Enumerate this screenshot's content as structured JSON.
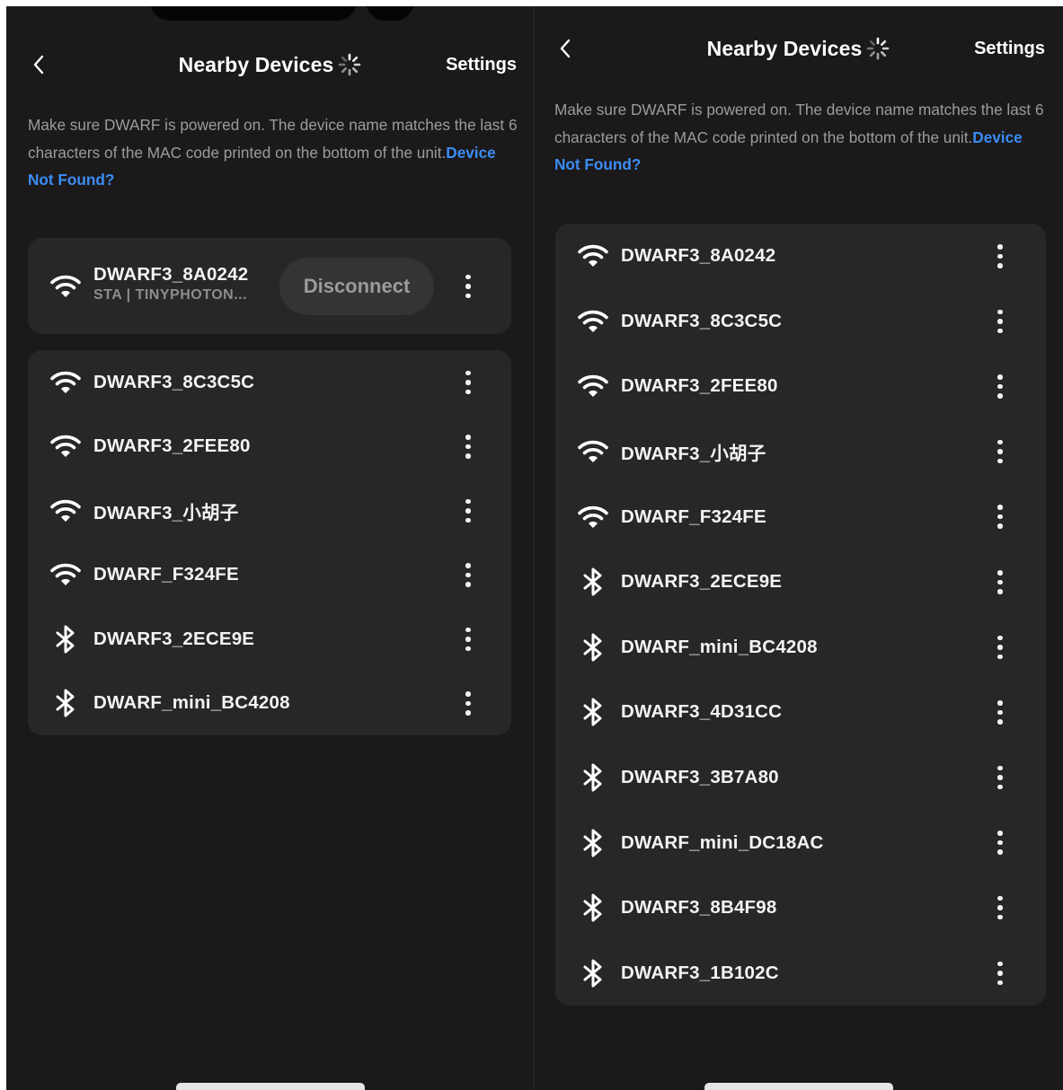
{
  "icons": {
    "wifi": "wifi-icon",
    "bluetooth": "bluetooth-icon",
    "back": "chevron-left-icon",
    "scan": "loading-spinner-icon",
    "more": "more-vertical-icon"
  },
  "colors": {
    "background": "#1b191a",
    "card": "#282627",
    "link": "#3b8df5",
    "muted_text": "#9d9b9c"
  },
  "left_screen": {
    "header": {
      "title": "Nearby Devices",
      "settings_label": "Settings"
    },
    "description": {
      "text": "Make sure DWARF is powered on. The device name matches the last 6 characters of the MAC code printed on the bottom of the unit.",
      "link": "Device Not Found?"
    },
    "connected_device": {
      "name": "DWARF3_8A0242",
      "subtitle": "STA | TINYPHOTON...",
      "icon": "wifi",
      "disconnect_label": "Disconnect"
    },
    "devices": [
      {
        "name": "DWARF3_8C3C5C",
        "icon": "wifi"
      },
      {
        "name": "DWARF3_2FEE80",
        "icon": "wifi"
      },
      {
        "name": "DWARF3_小胡子",
        "icon": "wifi"
      },
      {
        "name": "DWARF_F324FE",
        "icon": "wifi"
      },
      {
        "name": "DWARF3_2ECE9E",
        "icon": "bluetooth"
      },
      {
        "name": "DWARF_mini_BC4208",
        "icon": "bluetooth"
      }
    ]
  },
  "right_screen": {
    "header": {
      "title": "Nearby Devices",
      "settings_label": "Settings"
    },
    "description": {
      "text": "Make sure DWARF is powered on. The device name matches the last 6 characters of the MAC code printed on the bottom of the unit.",
      "link": "Device Not Found?"
    },
    "devices": [
      {
        "name": "DWARF3_8A0242",
        "icon": "wifi"
      },
      {
        "name": "DWARF3_8C3C5C",
        "icon": "wifi"
      },
      {
        "name": "DWARF3_2FEE80",
        "icon": "wifi"
      },
      {
        "name": "DWARF3_小胡子",
        "icon": "wifi"
      },
      {
        "name": "DWARF_F324FE",
        "icon": "wifi"
      },
      {
        "name": "DWARF3_2ECE9E",
        "icon": "bluetooth"
      },
      {
        "name": "DWARF_mini_BC4208",
        "icon": "bluetooth"
      },
      {
        "name": "DWARF3_4D31CC",
        "icon": "bluetooth"
      },
      {
        "name": "DWARF3_3B7A80",
        "icon": "bluetooth"
      },
      {
        "name": "DWARF_mini_DC18AC",
        "icon": "bluetooth"
      },
      {
        "name": "DWARF3_8B4F98",
        "icon": "bluetooth"
      },
      {
        "name": "DWARF3_1B102C",
        "icon": "bluetooth"
      }
    ]
  }
}
